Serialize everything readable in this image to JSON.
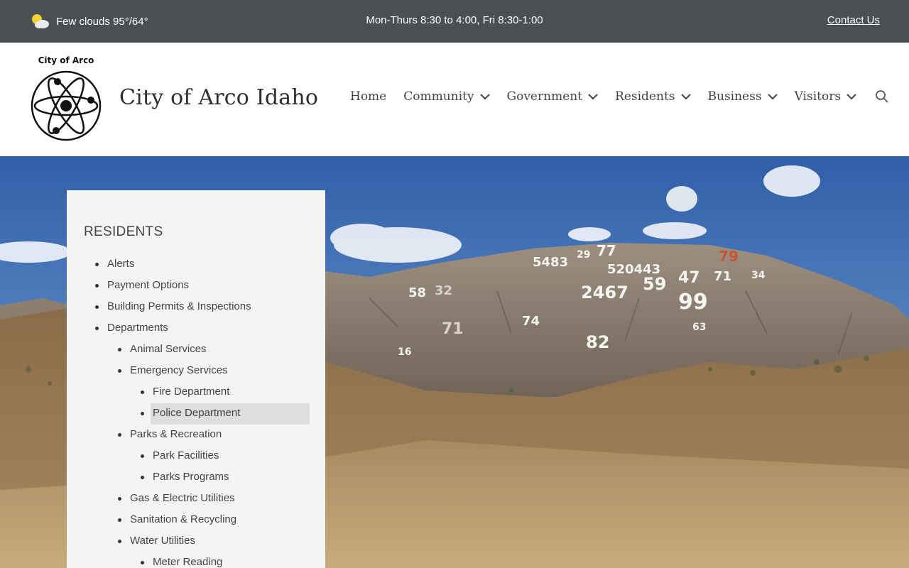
{
  "topbar": {
    "weather_text": "Few clouds 95°/64°",
    "weather_icon": "partly-cloudy-icon",
    "hours": "Mon-Thurs 8:30 to 4:00, Fri 8:30-1:00",
    "contact_label": "Contact Us"
  },
  "header": {
    "logo_caption": "City of Arco",
    "site_title": "City of Arco Idaho",
    "nav": [
      {
        "label": "Home"
      },
      {
        "label": "Community"
      },
      {
        "label": "Government"
      },
      {
        "label": "Residents"
      },
      {
        "label": "Business"
      },
      {
        "label": "Visitors"
      }
    ],
    "search_icon": "search-icon"
  },
  "sidebar": {
    "heading": "RESIDENTS",
    "items": [
      {
        "label": "Alerts",
        "level": 1
      },
      {
        "label": "Payment Options",
        "level": 1
      },
      {
        "label": "Building Permits & Inspections",
        "level": 1
      },
      {
        "label": "Departments",
        "level": 1
      },
      {
        "label": "Animal Services",
        "level": 2
      },
      {
        "label": "Emergency Services",
        "level": 2
      },
      {
        "label": "Fire Department",
        "level": 3
      },
      {
        "label": "Police Department",
        "level": 3,
        "active": true
      },
      {
        "label": "Parks & Recreation",
        "level": 2
      },
      {
        "label": "Park Facilities",
        "level": 3
      },
      {
        "label": "Parks Programs",
        "level": 3
      },
      {
        "label": "Gas & Electric Utilities",
        "level": 2
      },
      {
        "label": "Sanitation & Recycling",
        "level": 2
      },
      {
        "label": "Water Utilities",
        "level": 2
      },
      {
        "label": "Meter Reading",
        "level": 3
      }
    ]
  },
  "hero": {
    "hill_numbers": [
      "5483",
      "29",
      "77",
      "520443",
      "79",
      "58",
      "32",
      "2467",
      "59",
      "47",
      "71",
      "34",
      "99",
      "74",
      "82",
      "71",
      "16",
      "63"
    ]
  },
  "colors": {
    "topbar_bg": "#4a4f53",
    "sidebar_bg": "#f4f4f4",
    "active_item_bg": "#dedede"
  }
}
